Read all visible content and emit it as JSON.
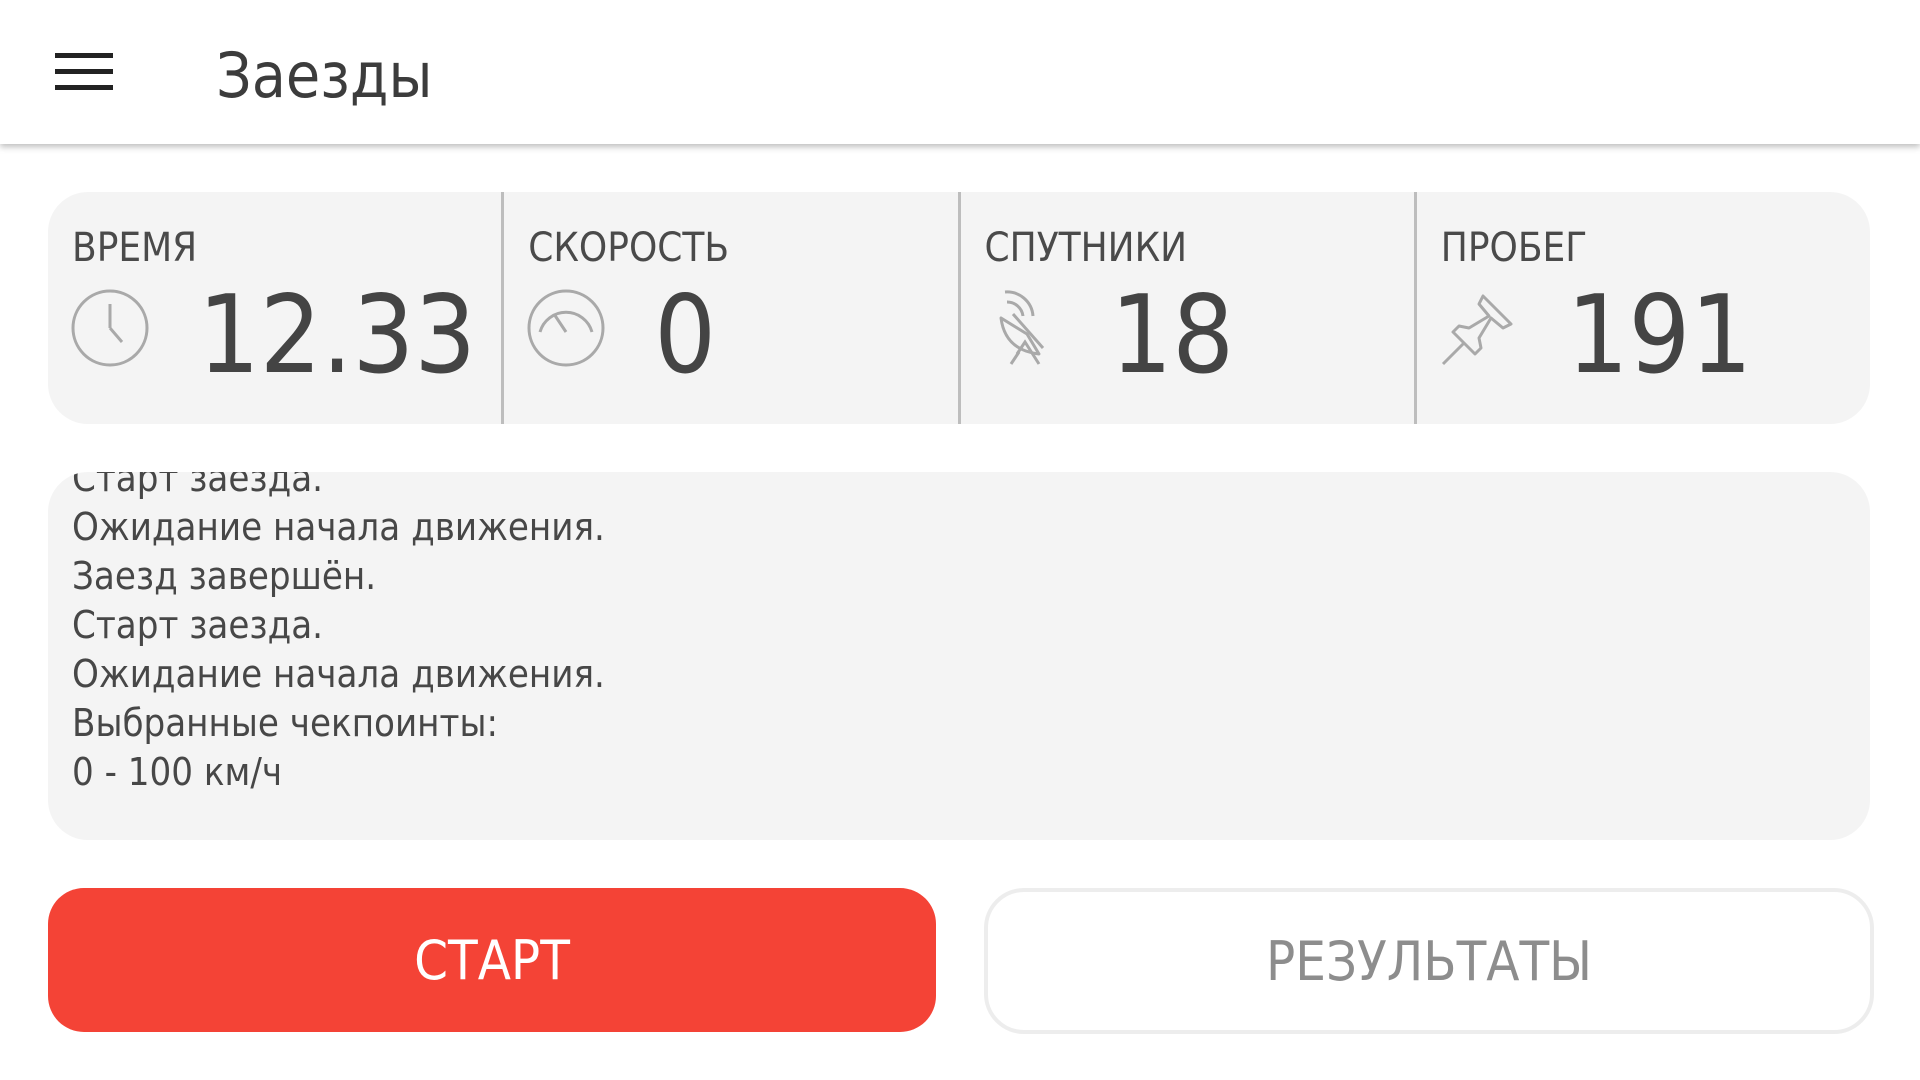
{
  "appbar": {
    "title": "Заезды",
    "menu_icon": "hamburger-menu-icon"
  },
  "stats": [
    {
      "label": "ВРЕМЯ",
      "value": "12.33",
      "icon": "clock-icon"
    },
    {
      "label": "СКОРОСТЬ",
      "value": "0",
      "icon": "speedometer-icon"
    },
    {
      "label": "СПУТНИКИ",
      "value": "18",
      "icon": "satellite-dish-icon"
    },
    {
      "label": "ПРОБЕГ",
      "value": "191",
      "icon": "pushpin-icon"
    }
  ],
  "log": {
    "lines": [
      "Старт заезда.",
      "Ожидание начала движения.",
      "Заезд завершён.",
      "Старт заезда.",
      "Ожидание начала движения.",
      "Выбранные чекпоинты:",
      "0 - 100 км/ч"
    ]
  },
  "buttons": {
    "start_label": "СТАРТ",
    "results_label": "РЕЗУЛЬТАТЫ"
  },
  "colors": {
    "accent": "#f44336",
    "panel_bg": "#f4f4f4",
    "text": "#444444",
    "muted_text": "#8d8d8d"
  }
}
